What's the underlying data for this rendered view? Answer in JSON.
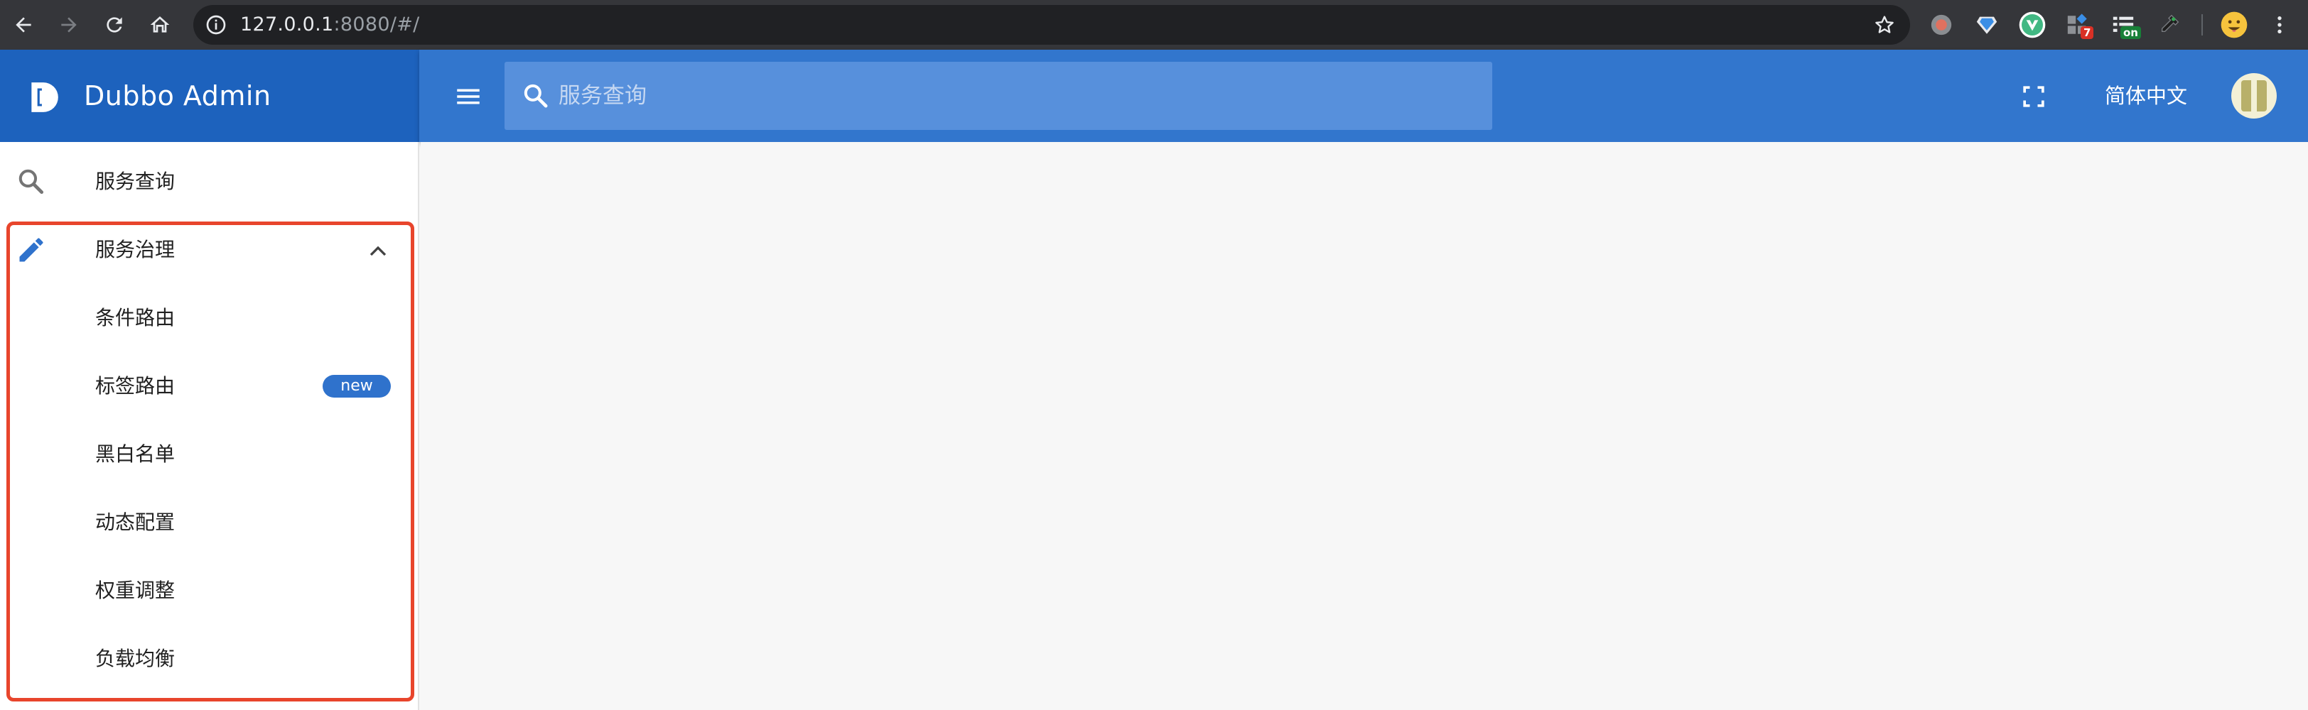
{
  "browser": {
    "url_host": "127.0.0.1",
    "url_rest": ":8080/#/",
    "extension_badges": {
      "ext4": "7",
      "ext5": "on"
    },
    "colors": {
      "chrome_bg": "#35363a",
      "omnibox_bg": "#202124"
    },
    "icons": [
      "back-icon",
      "forward-icon",
      "reload-icon",
      "home-icon",
      "info-icon",
      "star-icon",
      "menu-dots-icon"
    ]
  },
  "app": {
    "title": "Dubbo Admin",
    "colors": {
      "brand": "#1d62bd",
      "toolbar": "#3276cd",
      "accent": "#2f72cc",
      "highlight": "#e8452c"
    }
  },
  "header": {
    "search": {
      "placeholder": "服务查询",
      "value": ""
    },
    "language": "简体中文"
  },
  "sidebar": {
    "items": [
      {
        "label": "服务查询",
        "icon": "search-icon"
      },
      {
        "label": "服务治理",
        "icon": "pencil-icon",
        "expanded": true
      }
    ],
    "sub_items": [
      {
        "label": "条件路由"
      },
      {
        "label": "标签路由",
        "badge": "new"
      },
      {
        "label": "黑白名单"
      },
      {
        "label": "动态配置"
      },
      {
        "label": "权重调整"
      },
      {
        "label": "负载均衡"
      }
    ]
  }
}
